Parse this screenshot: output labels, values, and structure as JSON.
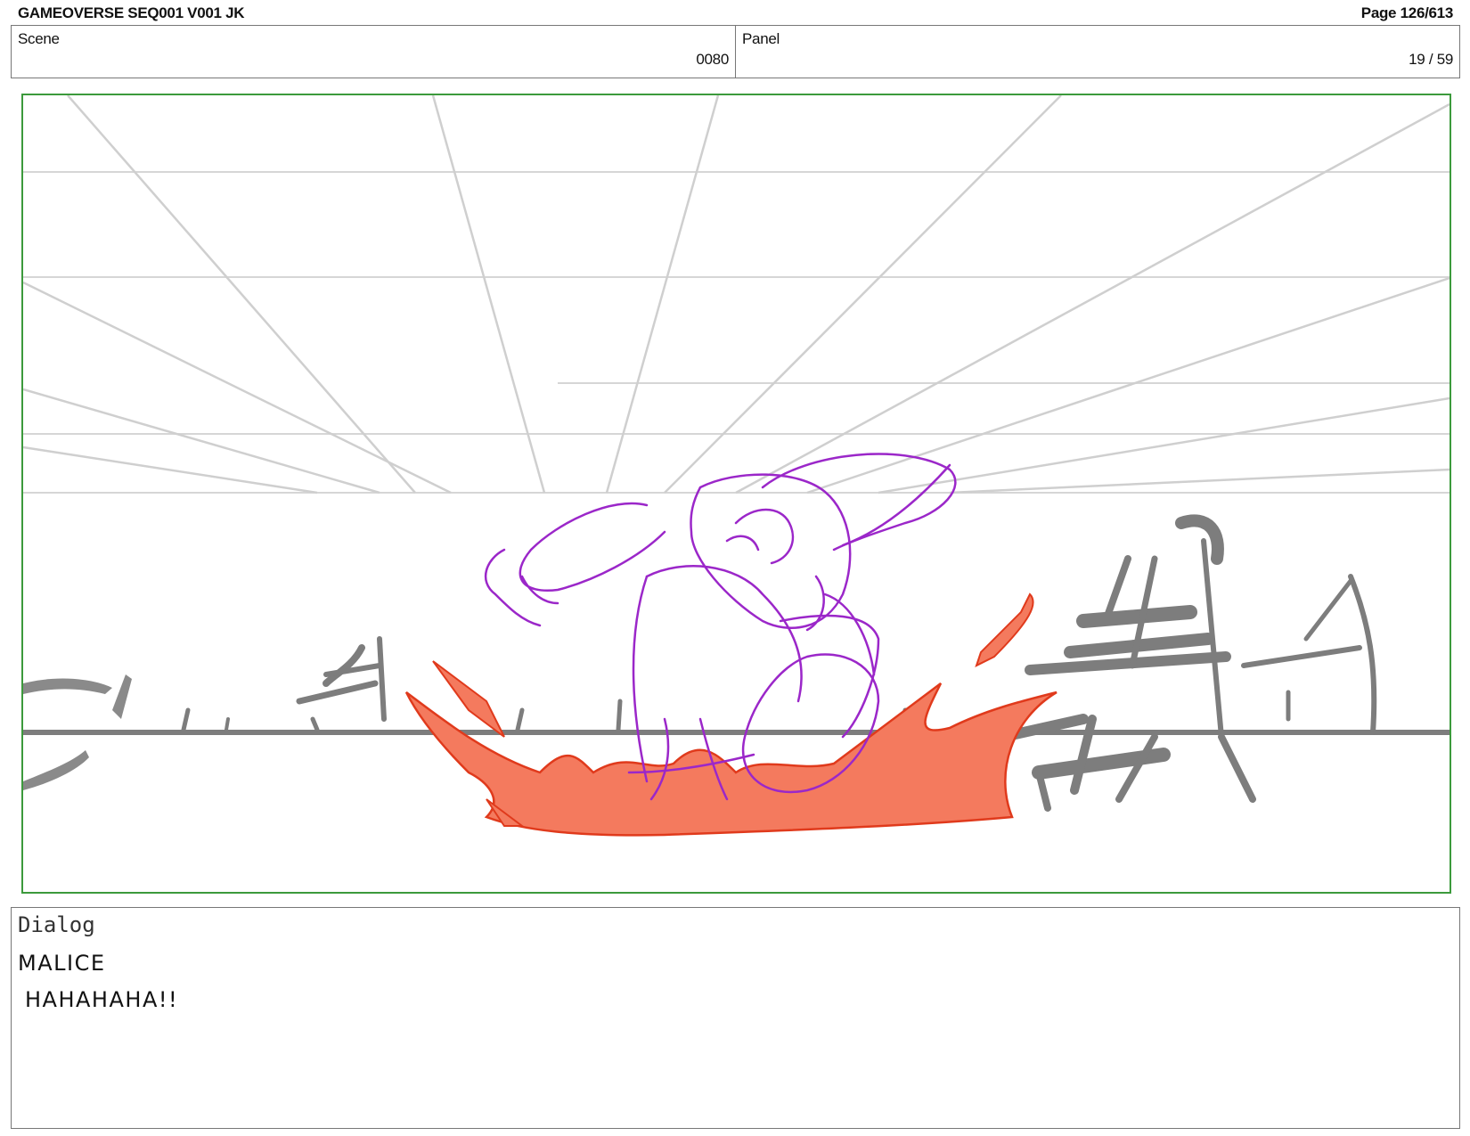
{
  "header": {
    "title": "GAMEOVERSE SEQ001 V001 JK",
    "page": "Page 126/613"
  },
  "scene": {
    "label": "Scene",
    "value": "0080"
  },
  "panel": {
    "label": "Panel",
    "value": "19 / 59"
  },
  "dialog": {
    "label": "Dialog",
    "speaker": "MALICE",
    "line": "HAHAHAHA!!"
  },
  "colors": {
    "frame_border": "#3c9a3c",
    "character_sketch": "#9b27c9",
    "impact_effect": "#f47a5e",
    "impact_outline": "#e03a1c",
    "background_sketch": "#7d7d7d",
    "perspective_lines": "#d0d0d0"
  }
}
